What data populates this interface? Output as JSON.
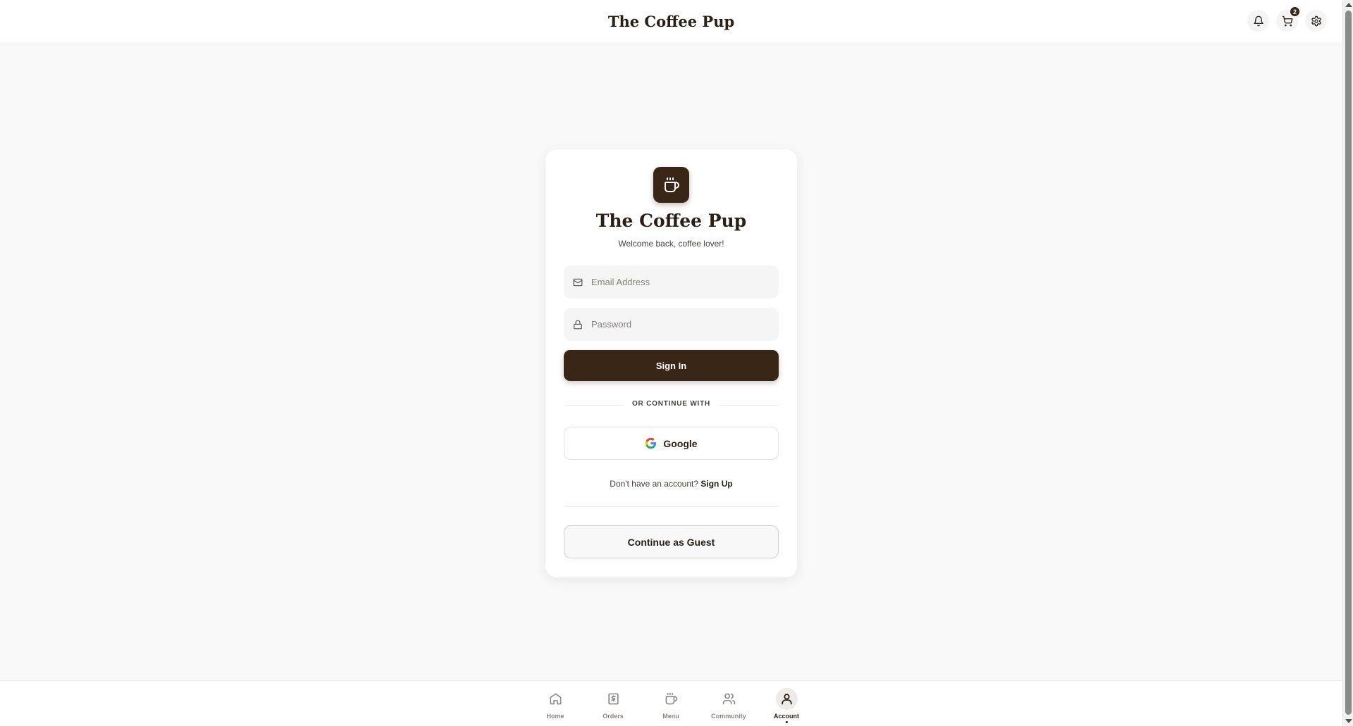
{
  "header": {
    "title": "The Coffee Pup",
    "cart_count": "2",
    "actions": [
      {
        "name": "notifications",
        "icon": "bell-icon"
      },
      {
        "name": "cart",
        "icon": "cart-icon"
      },
      {
        "name": "settings",
        "icon": "gear-icon"
      }
    ]
  },
  "login": {
    "logo_icon": "coffee-cup-icon",
    "title": "The Coffee Pup",
    "subtitle": "Welcome back, coffee lover!",
    "email": {
      "placeholder": "Email Address",
      "value": "",
      "icon": "mail-icon"
    },
    "password": {
      "placeholder": "Password",
      "value": "",
      "icon": "lock-icon"
    },
    "sign_in_label": "Sign In",
    "divider_text": "OR CONTINUE WITH",
    "google_label": "Google",
    "no_account_text": "Don't have an account?",
    "sign_up_label": "Sign Up",
    "guest_label": "Continue as Guest"
  },
  "nav": {
    "items": [
      {
        "label": "Home",
        "icon": "home-icon"
      },
      {
        "label": "Orders",
        "icon": "receipt-icon"
      },
      {
        "label": "Menu",
        "icon": "coffee-cup-icon"
      },
      {
        "label": "Community",
        "icon": "users-icon"
      },
      {
        "label": "Account",
        "icon": "user-icon",
        "active": true
      }
    ]
  },
  "colors": {
    "brand_dark": "#3a2616",
    "text": "#2b1e12",
    "background": "#f9f9f9",
    "muted": "#8a8580"
  }
}
